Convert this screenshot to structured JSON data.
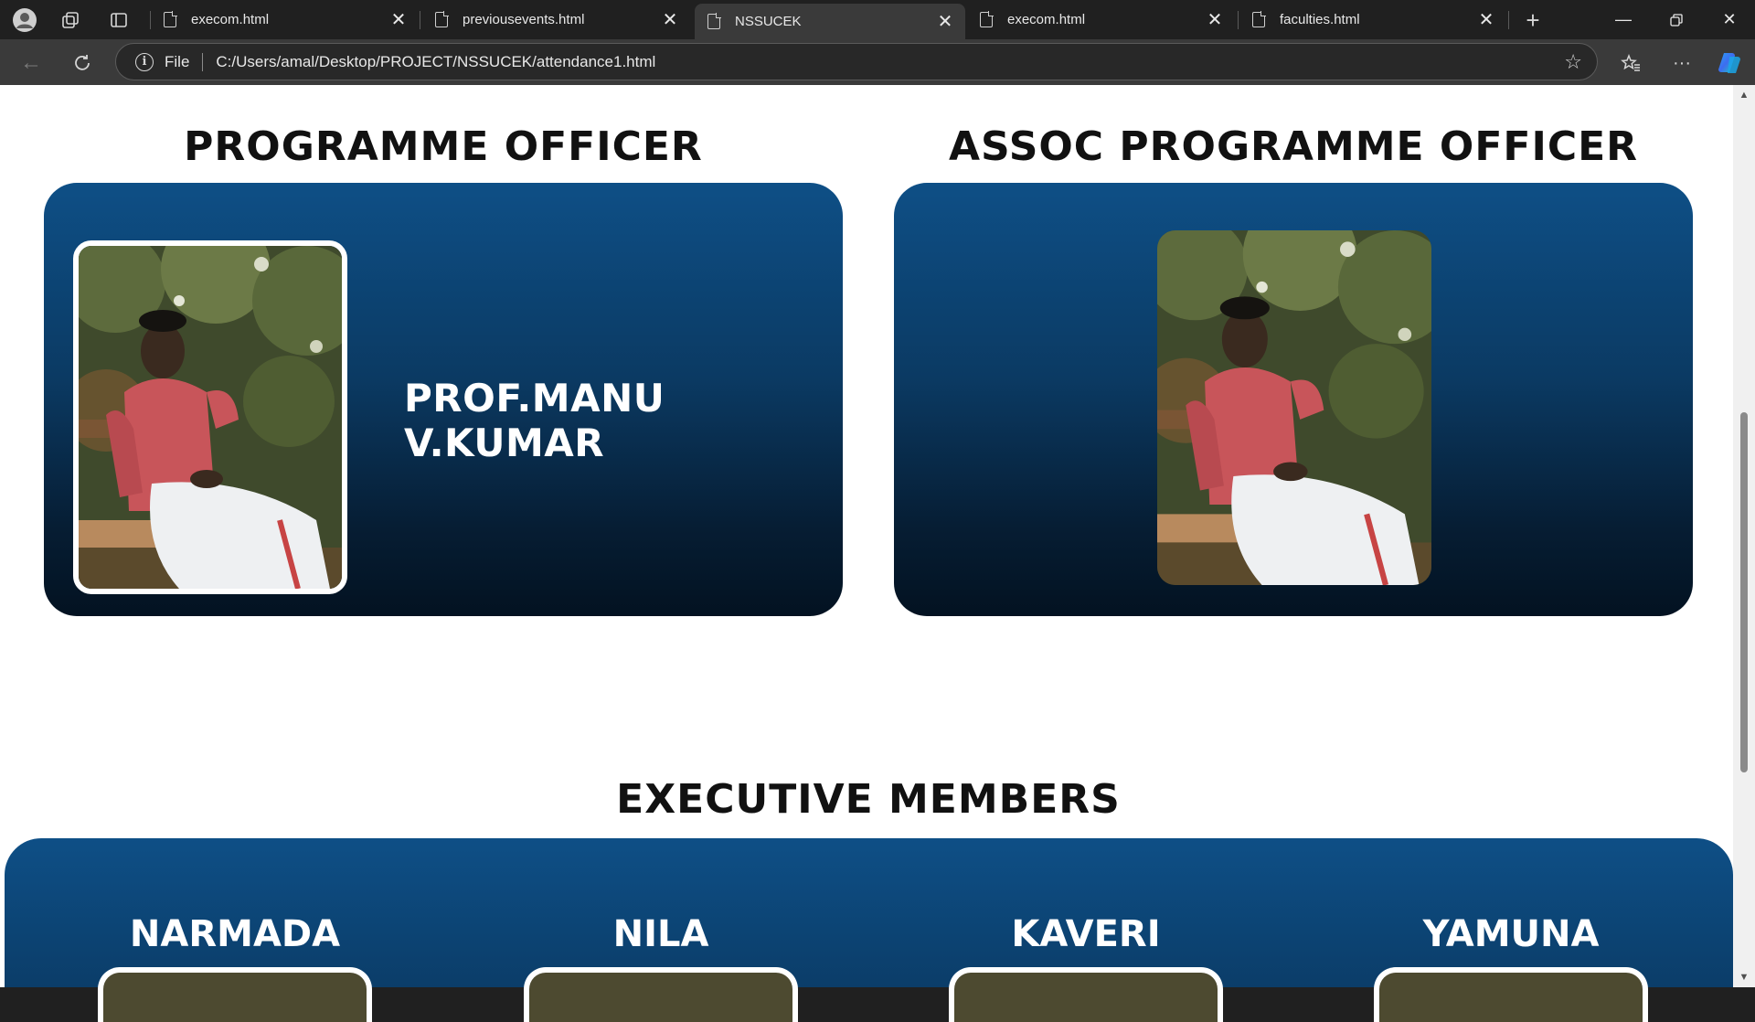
{
  "browser": {
    "tabs": [
      {
        "title": "execom.html",
        "active": false
      },
      {
        "title": "previousevents.html",
        "active": false
      },
      {
        "title": "NSSUCEK",
        "active": true
      },
      {
        "title": "execom.html",
        "active": false
      },
      {
        "title": "faculties.html",
        "active": false
      }
    ],
    "address": {
      "scheme_label": "File",
      "url": "C:/Users/amal/Desktop/PROJECT/NSSUCEK/attendance1.html"
    },
    "icons": [
      "profile-icon",
      "workspaces-icon",
      "tab-actions-icon",
      "new-tab-icon",
      "minimize-icon",
      "restore-icon",
      "close-icon",
      "back-icon",
      "refresh-icon",
      "info-icon",
      "favorite-star-icon",
      "favorites-icon",
      "more-icon",
      "copilot-icon"
    ]
  },
  "page": {
    "programme_officer": {
      "heading": "PROGRAMME OFFICER",
      "name": "PROF.MANU V.KUMAR"
    },
    "assoc_programme_officer": {
      "heading": "ASSOC PROGRAMME OFFICER"
    },
    "executive": {
      "heading": "EXECUTIVE MEMBERS",
      "members": [
        "NARMADA",
        "NILA",
        "KAVERI",
        "YAMUNA"
      ]
    },
    "colors": {
      "card_top": "#0e4f86",
      "card_bottom": "#031221",
      "heading_text": "#111111"
    }
  }
}
